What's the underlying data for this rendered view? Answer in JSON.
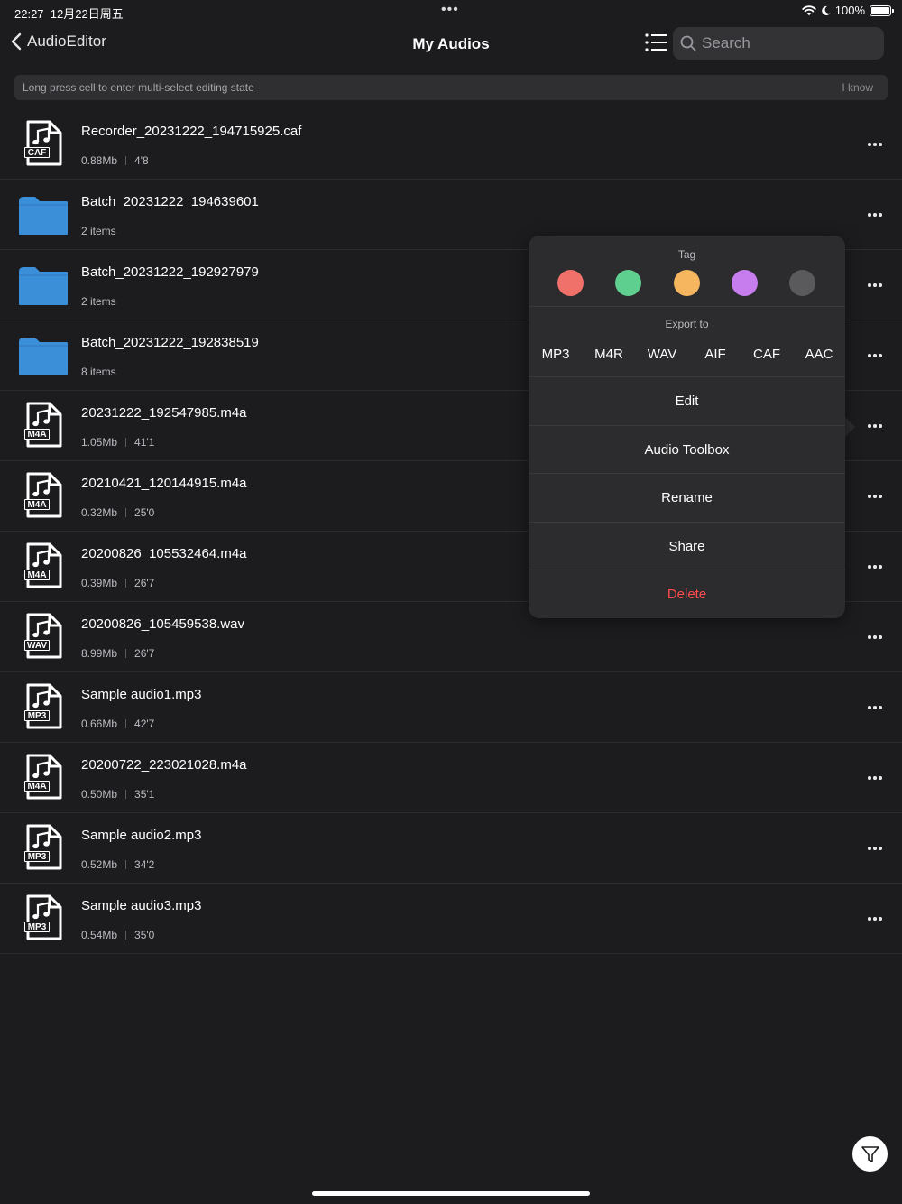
{
  "status_bar": {
    "time": "22:27",
    "date": "12月22日周五",
    "multitask": "•••",
    "battery": "100%",
    "battery_level": 1.0
  },
  "nav": {
    "back_label": "AudioEditor",
    "title": "My Audios",
    "search_placeholder": "Search"
  },
  "hint": {
    "text": "Long press cell to enter multi-select editing state",
    "dismiss": "I know"
  },
  "files": [
    {
      "type": "file",
      "badge": "CAF",
      "name": "Recorder_20231222_194715925.caf",
      "size": "0.88Mb",
      "duration": "4'8"
    },
    {
      "type": "folder",
      "name": "Batch_20231222_194639601",
      "items": "2 items"
    },
    {
      "type": "folder",
      "name": "Batch_20231222_192927979",
      "items": "2 items"
    },
    {
      "type": "folder",
      "name": "Batch_20231222_192838519",
      "items": "8 items"
    },
    {
      "type": "file",
      "badge": "M4A",
      "name": "20231222_192547985.m4a",
      "size": "1.05Mb",
      "duration": "41'1"
    },
    {
      "type": "file",
      "badge": "M4A",
      "name": "20210421_120144915.m4a",
      "size": "0.32Mb",
      "duration": "25'0"
    },
    {
      "type": "file",
      "badge": "M4A",
      "name": "20200826_105532464.m4a",
      "size": "0.39Mb",
      "duration": "26'7"
    },
    {
      "type": "file",
      "badge": "WAV",
      "name": "20200826_105459538.wav",
      "size": "8.99Mb",
      "duration": "26'7"
    },
    {
      "type": "file",
      "badge": "MP3",
      "name": "Sample audio1.mp3",
      "size": "0.66Mb",
      "duration": "42'7"
    },
    {
      "type": "file",
      "badge": "M4A",
      "name": "20200722_223021028.m4a",
      "size": "0.50Mb",
      "duration": "35'1"
    },
    {
      "type": "file",
      "badge": "MP3",
      "name": "Sample audio2.mp3",
      "size": "0.52Mb",
      "duration": "34'2"
    },
    {
      "type": "file",
      "badge": "MP3",
      "name": "Sample audio3.mp3",
      "size": "0.54Mb",
      "duration": "35'0"
    }
  ],
  "popover": {
    "tag_label": "Tag",
    "tag_colors": [
      {
        "name": "red",
        "hex": "#f0706a"
      },
      {
        "name": "green",
        "hex": "#5fcf8f"
      },
      {
        "name": "orange",
        "hex": "#f5b65f"
      },
      {
        "name": "purple",
        "hex": "#c77dee"
      },
      {
        "name": "gray",
        "hex": "#5a5a5c"
      }
    ],
    "export_label": "Export to",
    "export_formats": [
      "MP3",
      "M4R",
      "WAV",
      "AIF",
      "CAF",
      "AAC"
    ],
    "actions": [
      {
        "label": "Edit",
        "danger": false
      },
      {
        "label": "Audio Toolbox",
        "danger": false
      },
      {
        "label": "Rename",
        "danger": false
      },
      {
        "label": "Share",
        "danger": false
      },
      {
        "label": "Delete",
        "danger": true
      }
    ]
  },
  "colors": {
    "background": "#1c1c1e",
    "folder_blue": "#3b8fd9",
    "danger_red": "#ff4d4f",
    "popover_bg": "#2c2c2e"
  }
}
